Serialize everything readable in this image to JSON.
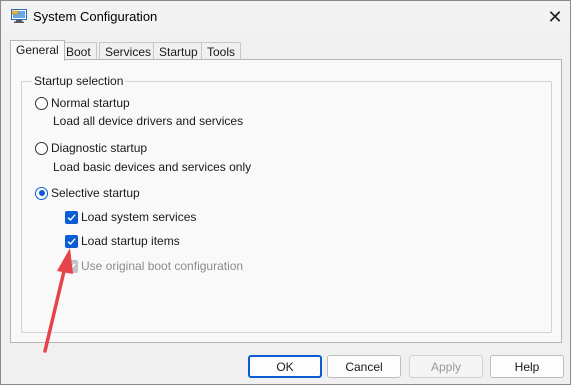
{
  "window": {
    "title": "System Configuration",
    "icon": "msconfig-icon",
    "close_glyph": "✕"
  },
  "tabs": [
    {
      "label": "General",
      "active": true
    },
    {
      "label": "Boot",
      "active": false
    },
    {
      "label": "Services",
      "active": false
    },
    {
      "label": "Startup",
      "active": false
    },
    {
      "label": "Tools",
      "active": false
    }
  ],
  "startup_selection": {
    "legend": "Startup selection",
    "normal": {
      "label": "Normal startup",
      "description": "Load all device drivers and services",
      "selected": false
    },
    "diagnostic": {
      "label": "Diagnostic startup",
      "description": "Load basic devices and services only",
      "selected": false
    },
    "selective": {
      "label": "Selective startup",
      "selected": true,
      "options": [
        {
          "label": "Load system services",
          "checked": true,
          "enabled": true
        },
        {
          "label": "Load startup items",
          "checked": true,
          "enabled": true
        },
        {
          "label": "Use original boot configuration",
          "checked": true,
          "enabled": false
        }
      ]
    }
  },
  "buttons": {
    "ok": "OK",
    "cancel": "Cancel",
    "apply": "Apply",
    "help": "Help"
  },
  "colors": {
    "accent": "#0a5cd6",
    "annotation_arrow": "#e8434a"
  }
}
